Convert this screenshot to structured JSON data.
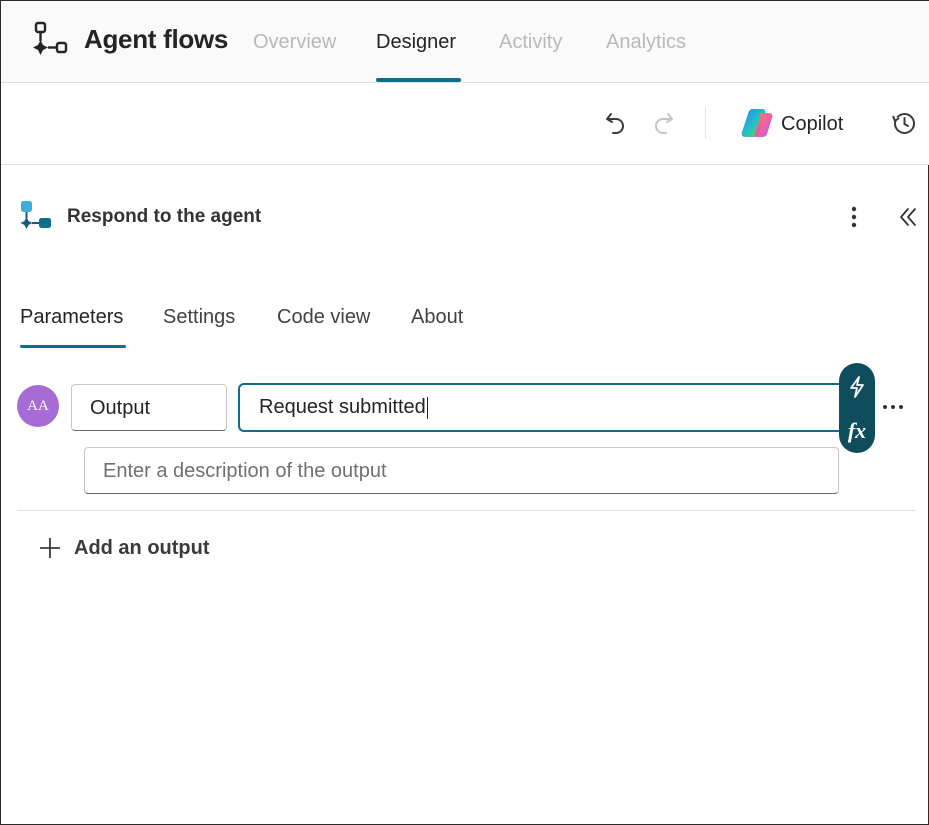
{
  "header": {
    "app_title": "Agent flows",
    "tabs": [
      {
        "label": "Overview",
        "active": false
      },
      {
        "label": "Designer",
        "active": true
      },
      {
        "label": "Activity",
        "active": false
      },
      {
        "label": "Analytics",
        "active": false
      }
    ]
  },
  "toolbar": {
    "undo_icon": "undo-icon",
    "redo_icon": "redo-icon",
    "copilot_label": "Copilot",
    "history_icon": "history-icon"
  },
  "panel": {
    "title": "Respond to the agent",
    "tabs": [
      {
        "label": "Parameters",
        "active": true
      },
      {
        "label": "Settings",
        "active": false
      },
      {
        "label": "Code view",
        "active": false
      },
      {
        "label": "About",
        "active": false
      }
    ]
  },
  "output": {
    "avatar_text": "AA",
    "name_value": "Output",
    "value_text": "Request submitted",
    "description_placeholder": "Enter a description of the output",
    "dynamic_content_icon": "lightning-icon",
    "expression_icon": "fx-icon"
  },
  "add_output_label": "Add an output",
  "colors": {
    "accent": "#0f6e8c",
    "pill": "#0f4c5c",
    "avatar": "#a66bd4"
  }
}
